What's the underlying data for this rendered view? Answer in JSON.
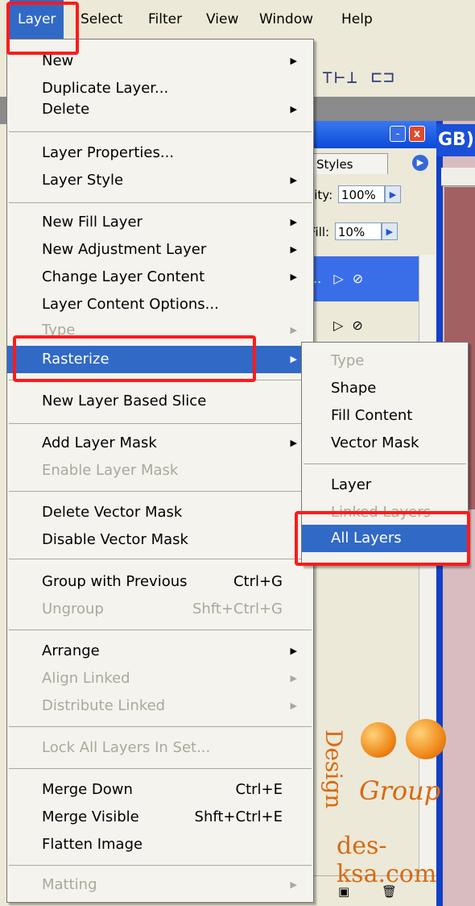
{
  "menubar": {
    "items": [
      "Layer",
      "Select",
      "Filter",
      "View",
      "Window",
      "Help"
    ]
  },
  "document": {
    "title_fragment": "GB)"
  },
  "layers_palette": {
    "tab_label": "Styles",
    "opacity_label": "city:",
    "opacity_value": "100%",
    "fill_label": "Fill:",
    "fill_value": "10%",
    "selected_row_text": "...",
    "close_glyph": "x",
    "minimize_glyph": "-"
  },
  "layer_menu": {
    "new": "New",
    "duplicate_layer": "Duplicate Layer...",
    "delete": "Delete",
    "layer_properties": "Layer Properties...",
    "layer_style": "Layer Style",
    "new_fill_layer": "New Fill Layer",
    "new_adjustment_layer": "New Adjustment Layer",
    "change_layer_content": "Change Layer Content",
    "layer_content_options": "Layer Content Options...",
    "type": "Type",
    "rasterize": "Rasterize",
    "new_layer_based_slice": "New Layer Based Slice",
    "add_layer_mask": "Add Layer Mask",
    "enable_layer_mask": "Enable Layer Mask",
    "delete_vector_mask": "Delete Vector Mask",
    "disable_vector_mask": "Disable Vector Mask",
    "group_with_previous": "Group with Previous",
    "group_with_previous_shortcut": "Ctrl+G",
    "ungroup": "Ungroup",
    "ungroup_shortcut": "Shft+Ctrl+G",
    "arrange": "Arrange",
    "align_linked": "Align Linked",
    "distribute_linked": "Distribute Linked",
    "lock_all_layers_in_set": "Lock All Layers In Set...",
    "merge_down": "Merge Down",
    "merge_down_shortcut": "Ctrl+E",
    "merge_visible": "Merge Visible",
    "merge_visible_shortcut": "Shft+Ctrl+E",
    "flatten_image": "Flatten Image",
    "matting": "Matting"
  },
  "rasterize_submenu": {
    "type": "Type",
    "shape": "Shape",
    "fill_content": "Fill Content",
    "vector_mask": "Vector Mask",
    "layer": "Layer",
    "linked_layers": "Linked Layers",
    "all_layers": "All Layers"
  },
  "watermark": {
    "design": "Design",
    "group": "Group",
    "site": "des-ksa.com"
  },
  "colors": {
    "menu_highlight": "#3169c6",
    "annotation_red": "#ff1a1a",
    "disabled_text": "#aca899",
    "watermark_orange": "#d86a12"
  }
}
